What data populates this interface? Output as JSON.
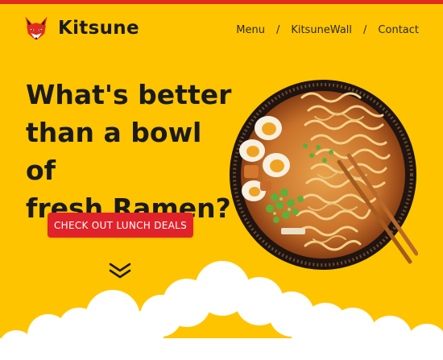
{
  "brand": {
    "name": "Kitsune",
    "logo_icon": "fox-logo-icon"
  },
  "nav": {
    "items": [
      "Menu",
      "KitsuneWall",
      "Contact"
    ],
    "separator": "/"
  },
  "hero": {
    "heading_line1": "What's better",
    "heading_line2": "than a bowl of",
    "heading_line3": "fresh Ramen?",
    "cta_label": "CHECK OUT LUNCH DEALS",
    "scroll_icon": "double-chevron-down-icon"
  },
  "colors": {
    "background": "#ffc400",
    "accent_red": "#e02b1f",
    "button": "#e0232b",
    "text": "#1a1a1a"
  }
}
